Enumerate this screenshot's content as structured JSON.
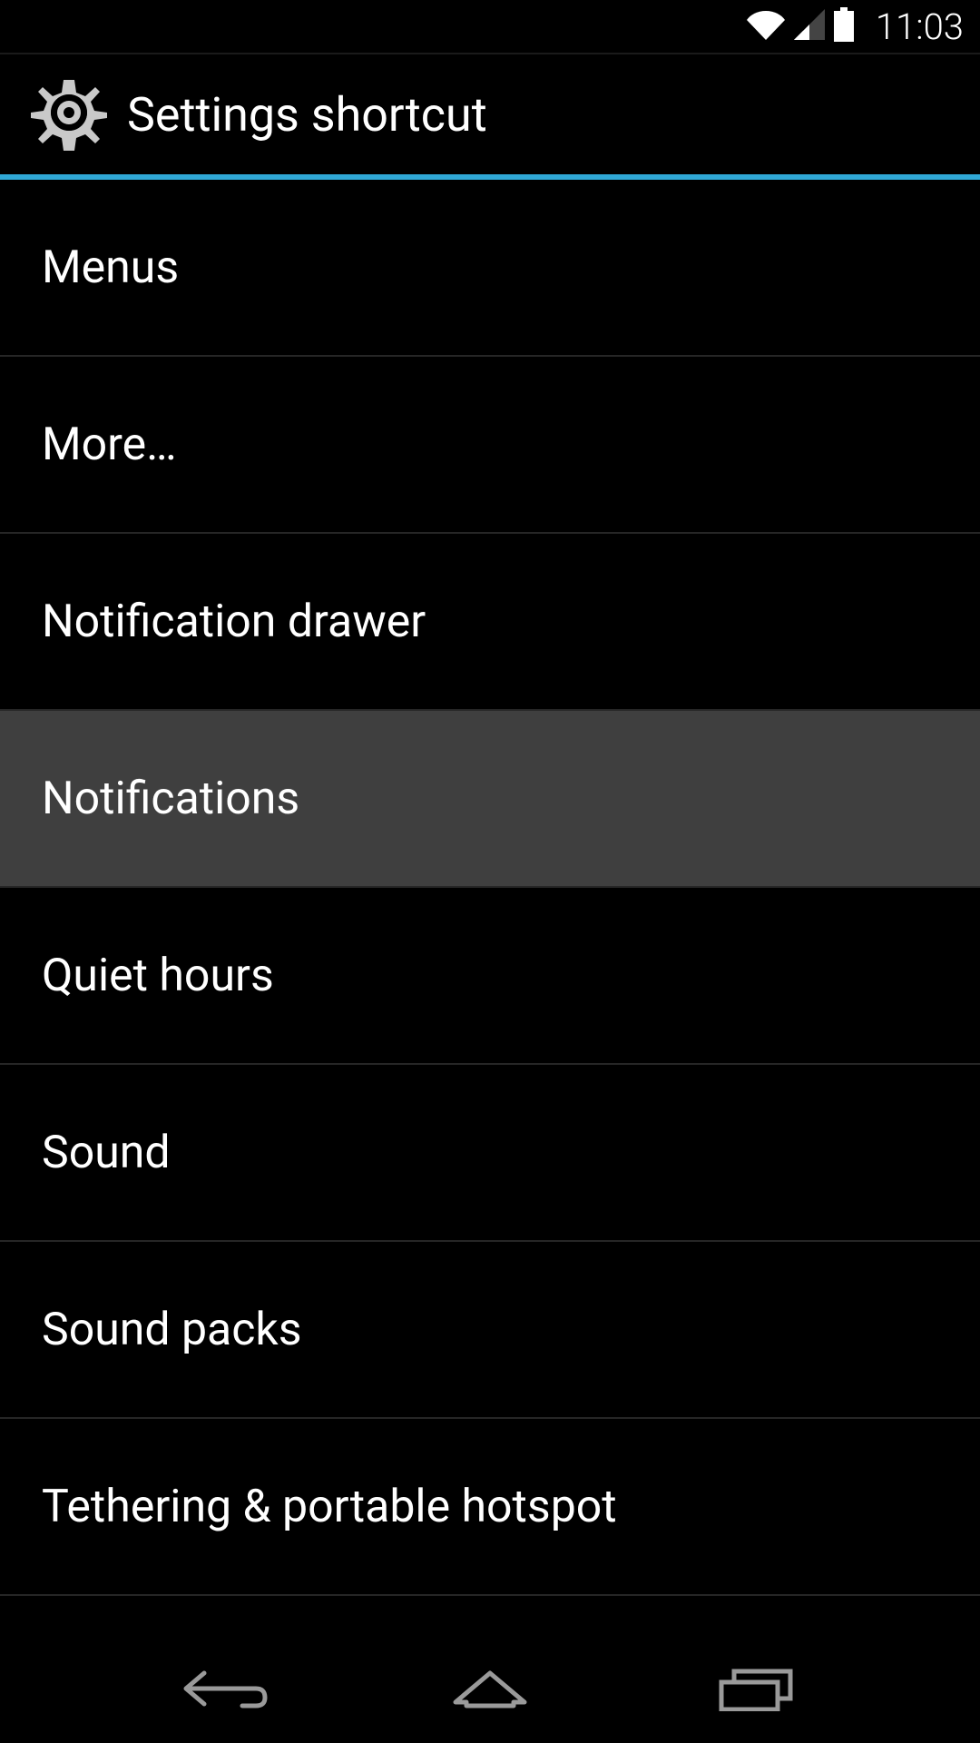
{
  "status_bar": {
    "time": "11:03"
  },
  "header": {
    "title": "Settings shortcut"
  },
  "list": {
    "items": [
      {
        "label": "Menus",
        "highlighted": false
      },
      {
        "label": "More…",
        "highlighted": false
      },
      {
        "label": "Notification drawer",
        "highlighted": false
      },
      {
        "label": "Notifications",
        "highlighted": true
      },
      {
        "label": "Quiet hours",
        "highlighted": false
      },
      {
        "label": "Sound",
        "highlighted": false
      },
      {
        "label": "Sound packs",
        "highlighted": false
      },
      {
        "label": "Tethering & portable hotspot",
        "highlighted": false
      }
    ]
  }
}
